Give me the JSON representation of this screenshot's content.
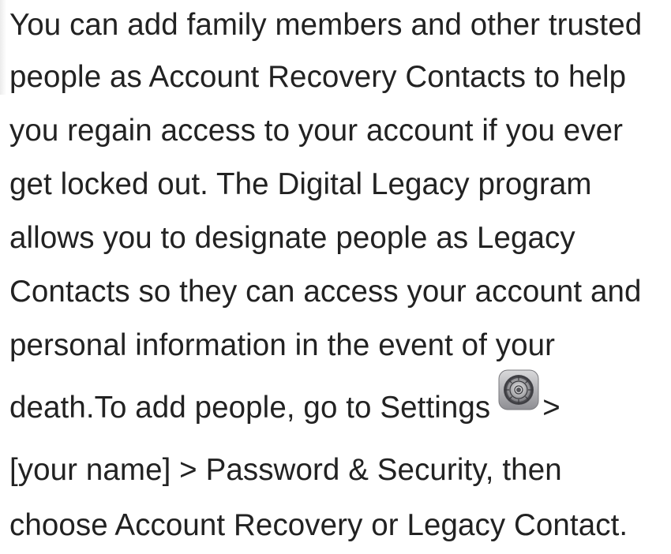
{
  "paragraph": {
    "line1": "You can add family members and other trusted",
    "line2": "people as Account Recovery Contacts to help",
    "line3": "you regain access to your account if you ever",
    "line4": "get locked out. The Digital Legacy program",
    "line5": "allows you to designate people as Legacy",
    "line6": "Contacts so they can access your account and",
    "line7": "personal information in the event of your",
    "line8_before_icon": "death.To add people, go to Settings",
    "line8_after_icon": ">",
    "line9": "[your name] > Password & Security, then",
    "line10": "choose Account Recovery or Legacy Contact."
  },
  "icons": {
    "settings": "settings-gear-icon"
  },
  "colors": {
    "text": "#222222",
    "background": "#ffffff"
  }
}
